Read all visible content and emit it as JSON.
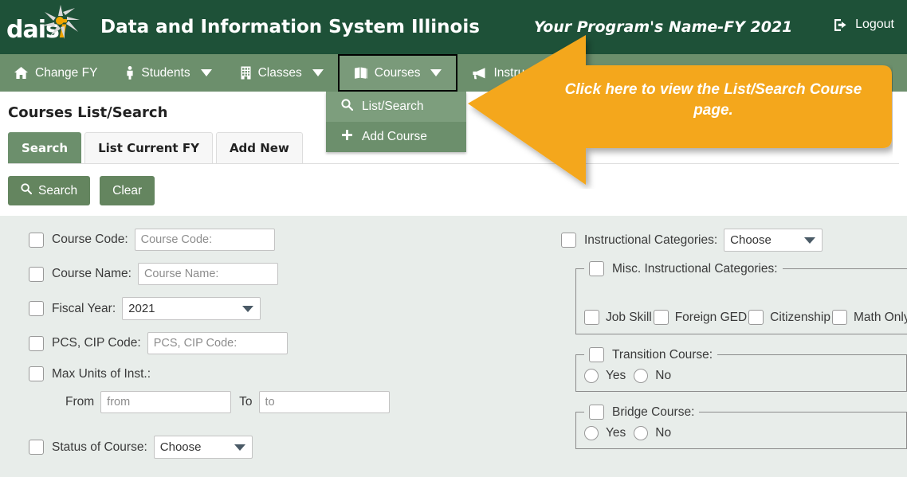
{
  "header": {
    "logo_text_main": "dais",
    "logo_text_accent": "i",
    "title": "Data and Information System Illinois",
    "program_name": "Your Program's Name-FY 2021",
    "logout_label": "Logout"
  },
  "nav": {
    "items": [
      {
        "label": "Change FY",
        "icon": "home-icon",
        "caret": false
      },
      {
        "label": "Students",
        "icon": "person-icon",
        "caret": true
      },
      {
        "label": "Classes",
        "icon": "building-icon",
        "caret": true
      },
      {
        "label": "Courses",
        "icon": "book-icon",
        "caret": true,
        "active": true
      },
      {
        "label": "Instructors",
        "icon": "megaphone-icon",
        "caret": false
      }
    ]
  },
  "dropdown": {
    "items": [
      {
        "label": "List/Search",
        "icon": "search-icon",
        "hover": true
      },
      {
        "label": "Add Course",
        "icon": "plus-icon",
        "hover": false
      }
    ]
  },
  "main": {
    "page_title": "Courses List/Search",
    "tabs": [
      {
        "label": "Search",
        "active": true
      },
      {
        "label": "List Current FY",
        "active": false
      },
      {
        "label": "Add New",
        "active": false
      }
    ],
    "buttons": {
      "search": "Search",
      "clear": "Clear"
    }
  },
  "form": {
    "left": {
      "course_code_label": "Course Code:",
      "course_code_placeholder": "Course Code:",
      "course_name_label": "Course Name:",
      "course_name_placeholder": "Course Name:",
      "fiscal_year_label": "Fiscal Year:",
      "fiscal_year_value": "2021",
      "pcs_cip_label": "PCS, CIP Code:",
      "pcs_cip_placeholder": "PCS, CIP Code:",
      "max_units_label": "Max Units of Inst.:",
      "from_label": "From",
      "from_placeholder": "from",
      "to_label": "To",
      "to_placeholder": "to",
      "status_label": "Status of Course:",
      "status_value": "Choose"
    },
    "right": {
      "instructional_categories_label": "Instructional Categories:",
      "instructional_categories_value": "Choose",
      "misc_legend": "Misc. Instructional Categories:",
      "misc_options": [
        "Job Skill",
        "Foreign GED",
        "Citizenship",
        "Math Only"
      ],
      "transition_legend": "Transition Course:",
      "transition_yes": "Yes",
      "transition_no": "No",
      "bridge_legend": "Bridge Course:",
      "bridge_yes": "Yes",
      "bridge_no": "No"
    }
  },
  "callout": {
    "text": "Click here to view the List/Search Course page."
  },
  "colors": {
    "header_green": "#1e5138",
    "nav_green": "#6c8f6c",
    "button_green": "#64855f",
    "panel_bg": "#e8edea",
    "callout_orange": "#f4a71d",
    "logo_accent": "#f0a500"
  }
}
